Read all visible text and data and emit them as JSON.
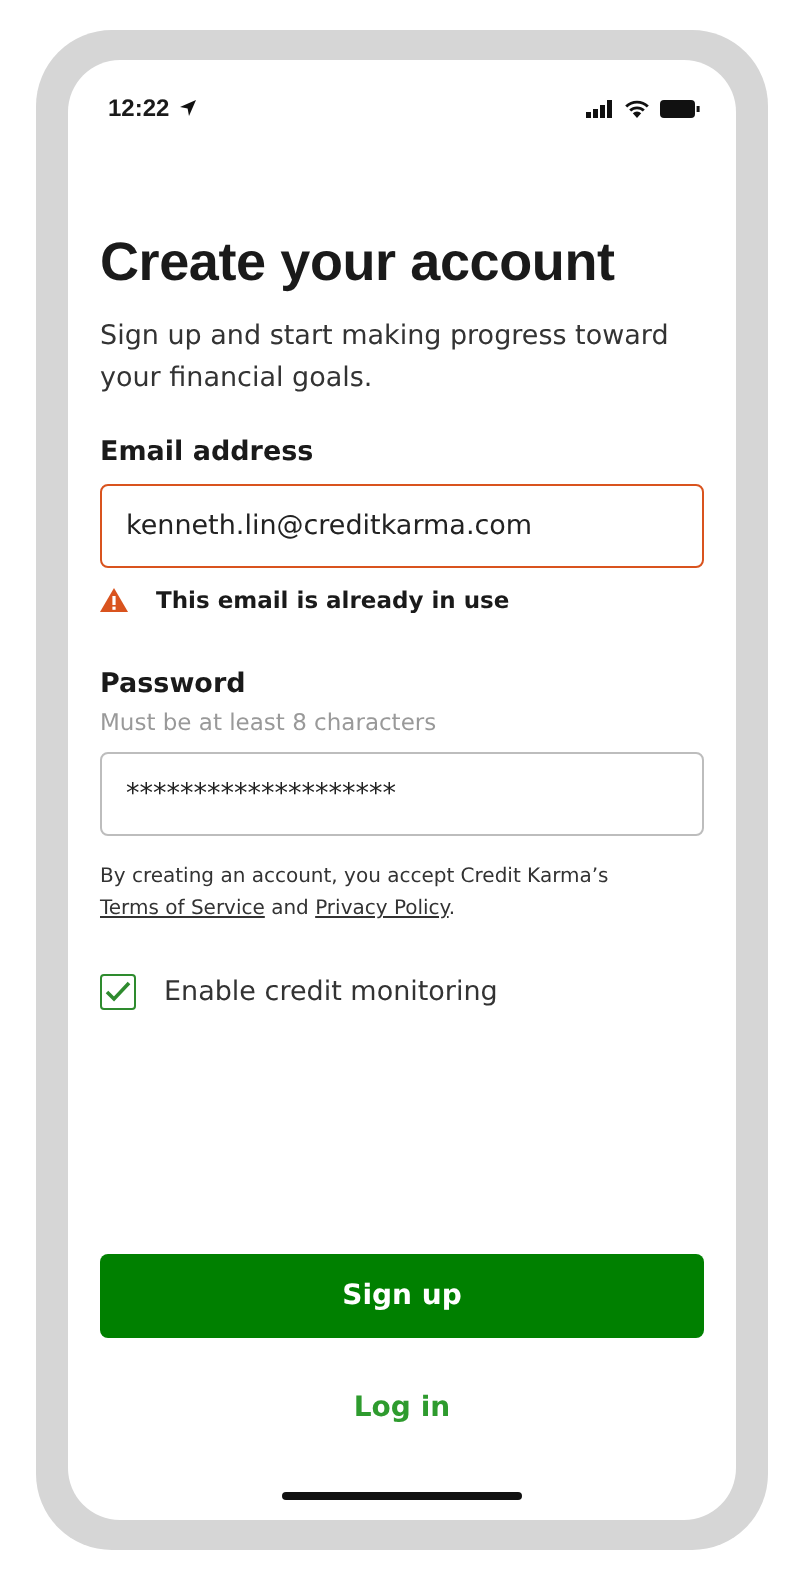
{
  "status_bar": {
    "time": "12:22"
  },
  "title": "Create your account",
  "subtitle": "Sign up and start making progress toward your financial goals.",
  "email": {
    "label": "Email address",
    "value": "kenneth.lin@creditkarma.com",
    "error": "This email is already in use"
  },
  "password": {
    "label": "Password",
    "hint": "Must be at least 8 characters",
    "value": "********************"
  },
  "terms": [
    {
      "kind": "text",
      "text": "By creating an account, you accept Credit Karma’s "
    },
    {
      "kind": "link",
      "text": "Terms of Service"
    },
    {
      "kind": "text",
      "text": " and "
    },
    {
      "kind": "link",
      "text": "Privacy Policy"
    },
    {
      "kind": "text",
      "text": "."
    }
  ],
  "monitoring": {
    "label": "Enable credit monitoring",
    "checked": true
  },
  "buttons": {
    "primary": "Sign up",
    "secondary": "Log in"
  }
}
